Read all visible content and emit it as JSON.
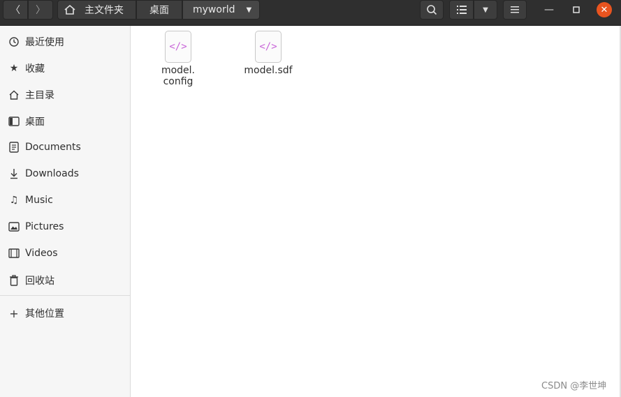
{
  "header": {
    "back_glyph": "〈",
    "forward_glyph": "〉",
    "breadcrumbs": [
      {
        "label": "主文件夹",
        "icon": "home-icon"
      },
      {
        "label": "桌面"
      },
      {
        "label": "myworld",
        "icon": "chevron-down-icon"
      }
    ],
    "icons": [
      "search-icon",
      "list-view-icon",
      "chevron-down-icon",
      "hamburger-menu-icon"
    ],
    "window_controls": [
      "minimize-icon",
      "maximize-icon",
      "close-icon"
    ]
  },
  "sidebar": {
    "items": [
      {
        "label": "最近使用",
        "icon": "clock-icon"
      },
      {
        "label": "收藏",
        "icon": "star-icon"
      },
      {
        "label": "主目录",
        "icon": "home-icon"
      },
      {
        "label": "桌面",
        "icon": "desktop-icon"
      },
      {
        "label": "Documents",
        "icon": "document-icon"
      },
      {
        "label": "Downloads",
        "icon": "download-icon"
      },
      {
        "label": "Music",
        "icon": "music-icon"
      },
      {
        "label": "Pictures",
        "icon": "picture-icon"
      },
      {
        "label": "Videos",
        "icon": "video-icon"
      },
      {
        "label": "回收站",
        "icon": "trash-icon"
      }
    ],
    "other": {
      "label": "其他位置",
      "icon": "plus-icon"
    }
  },
  "files": [
    {
      "name_line1": "model.",
      "name_line2": "config",
      "icon": "code-file-icon"
    },
    {
      "name_line1": "model.sdf",
      "name_line2": "",
      "icon": "code-file-icon"
    }
  ],
  "file_icon_glyph": "</>",
  "watermark": "CSDN @李世坤",
  "colors": {
    "header_bg": "#2f2f2f",
    "sidebar_bg": "#f6f6f6",
    "accent_close": "#e9541f",
    "code_icon": "#c864d8"
  }
}
